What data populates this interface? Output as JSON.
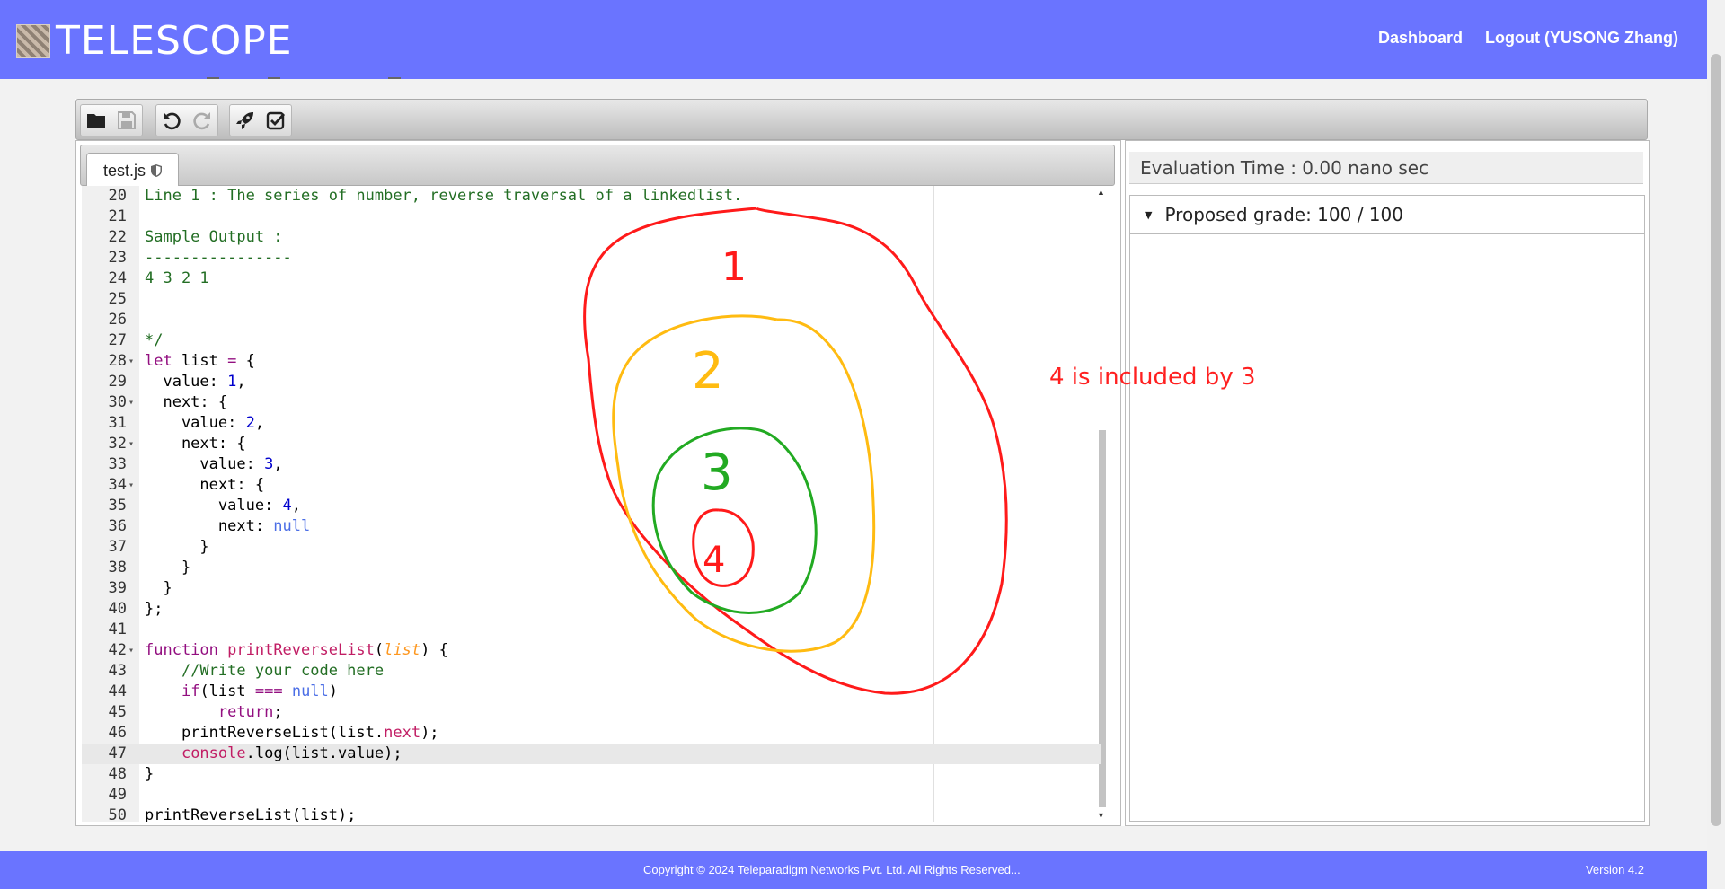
{
  "header": {
    "logo_text": "TELESCOPE",
    "nav": {
      "dashboard": "Dashboard",
      "logout": "Logout (YUSONG Zhang)"
    }
  },
  "toolbar": {
    "icons": [
      "folder-icon",
      "save-icon",
      "undo-icon",
      "redo-icon",
      "rocket-icon",
      "check-square-icon"
    ]
  },
  "editor": {
    "tab_name": "test.js",
    "lines": [
      {
        "n": "20",
        "fold": "",
        "html": "<span class='c-comment'>Line 1 : The series of number, reverse traversal of a linkedlist.</span>"
      },
      {
        "n": "21",
        "fold": "",
        "html": ""
      },
      {
        "n": "22",
        "fold": "",
        "html": "<span class='c-comment'>Sample Output :</span>"
      },
      {
        "n": "23",
        "fold": "",
        "html": "<span class='c-comment'>----------------</span>"
      },
      {
        "n": "24",
        "fold": "",
        "html": "<span class='c-comment'>4 3 2 1</span>"
      },
      {
        "n": "25",
        "fold": "",
        "html": ""
      },
      {
        "n": "26",
        "fold": "",
        "html": ""
      },
      {
        "n": "27",
        "fold": "",
        "html": "<span class='c-comment'>*/</span>"
      },
      {
        "n": "28",
        "fold": "▾",
        "html": "<span class='c-kw'>let</span> list <span class='c-kw'>=</span> {"
      },
      {
        "n": "29",
        "fold": "",
        "html": "  value: <span class='c-num'>1</span>,"
      },
      {
        "n": "30",
        "fold": "▾",
        "html": "  next: {"
      },
      {
        "n": "31",
        "fold": "",
        "html": "    value: <span class='c-num'>2</span>,"
      },
      {
        "n": "32",
        "fold": "▾",
        "html": "    next: {"
      },
      {
        "n": "33",
        "fold": "",
        "html": "      value: <span class='c-num'>3</span>,"
      },
      {
        "n": "34",
        "fold": "▾",
        "html": "      next: {"
      },
      {
        "n": "35",
        "fold": "",
        "html": "        value: <span class='c-num'>4</span>,"
      },
      {
        "n": "36",
        "fold": "",
        "html": "        next: <span class='c-const'>null</span>"
      },
      {
        "n": "37",
        "fold": "",
        "html": "      }"
      },
      {
        "n": "38",
        "fold": "",
        "html": "    }"
      },
      {
        "n": "39",
        "fold": "",
        "html": "  }"
      },
      {
        "n": "40",
        "fold": "",
        "html": "};"
      },
      {
        "n": "41",
        "fold": "",
        "html": ""
      },
      {
        "n": "42",
        "fold": "▾",
        "html": "<span class='c-kw'>function</span> <span class='c-fn'>printReverseList</span>(<span class='c-param'>list</span>) {"
      },
      {
        "n": "43",
        "fold": "",
        "html": "    <span class='c-comment'>//Write your code here</span>"
      },
      {
        "n": "44",
        "fold": "",
        "html": "    <span class='c-kw'>if</span>(list <span class='c-kw'>===</span> <span class='c-const'>null</span>)"
      },
      {
        "n": "45",
        "fold": "",
        "html": "        <span class='c-kw'>return</span>;"
      },
      {
        "n": "46",
        "fold": "",
        "html": "    printReverseList(list.<span class='c-fn'>next</span>);"
      },
      {
        "n": "47",
        "fold": "",
        "html": "    <span class='c-fn'>console</span>.log(list.value);"
      },
      {
        "n": "48",
        "fold": "",
        "html": "}"
      },
      {
        "n": "49",
        "fold": "",
        "html": ""
      },
      {
        "n": "50",
        "fold": "",
        "html": "printReverseList(list);"
      }
    ],
    "active_line": "47"
  },
  "side": {
    "eval_time": "Evaluation Time : 0.00 nano sec",
    "grade": "Proposed grade: 100 / 100"
  },
  "annotation": {
    "text": "4 is included by 3",
    "circle_labels": [
      "1",
      "2",
      "3",
      "4"
    ],
    "colors": {
      "outer": "#ff1a1a",
      "second": "#ffbb11",
      "third": "#22aa22",
      "inner": "#ff1a1a"
    }
  },
  "footer": {
    "copyright": "Copyright © 2024 Teleparadigm Networks Pvt. Ltd. All Rights Reserved...",
    "version": "Version 4.2"
  },
  "colors": {
    "header": "#6a74ff",
    "footer": "#6a74ff"
  }
}
